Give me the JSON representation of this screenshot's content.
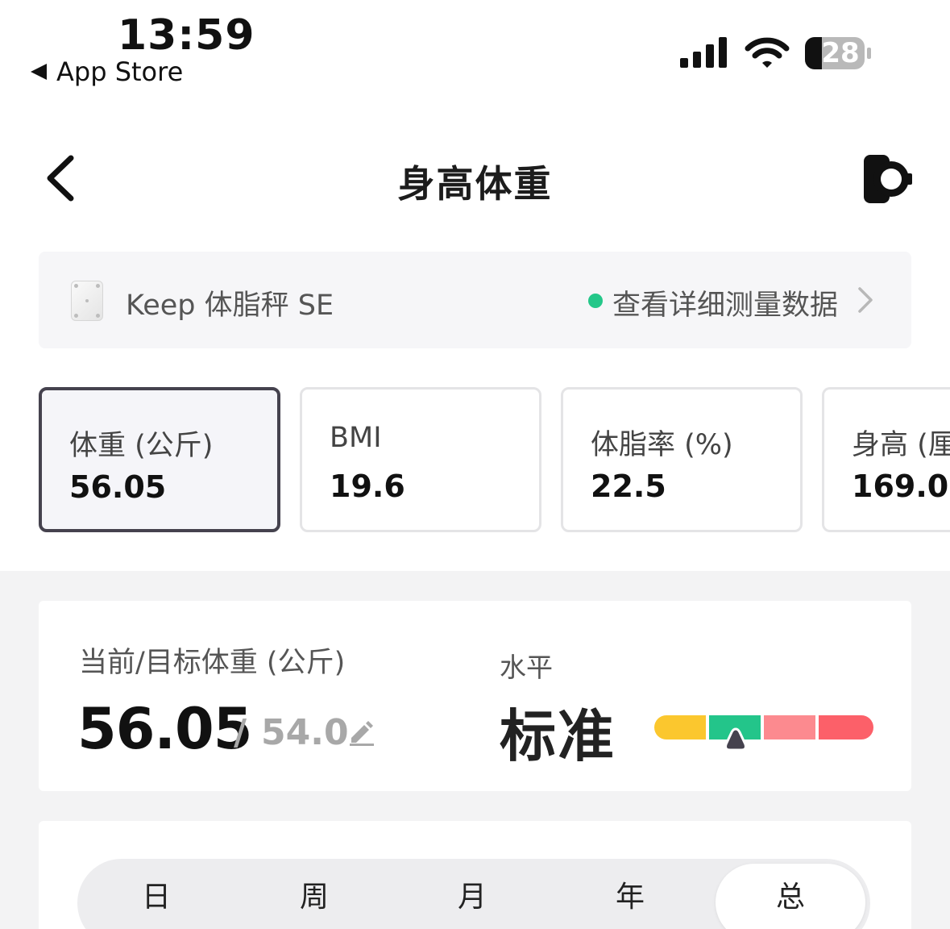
{
  "status_bar": {
    "time": "13:59",
    "back_app": "App Store",
    "battery": "28"
  },
  "nav": {
    "title": "身高体重",
    "icons": [
      "back-chevron-icon",
      "smartwatch-icon"
    ]
  },
  "device": {
    "name": "Keep 体脂秤 SE",
    "link": "查看详细测量数据",
    "status_color": "#24c789"
  },
  "metrics": [
    {
      "label": "体重 (公斤)",
      "value": "56.05",
      "selected": true
    },
    {
      "label": "BMI",
      "value": "19.6"
    },
    {
      "label": "体脂率 (%)",
      "value": "22.5"
    },
    {
      "label": "身高 (厘",
      "value": "169.0"
    }
  ],
  "weight": {
    "label": "当前/目标体重 (公斤)",
    "current": "56.05",
    "separator": "/",
    "target": "54.0",
    "level_label": "水平",
    "level": "标准",
    "level_scale": {
      "colors": [
        "#fbc72e",
        "#23c58a",
        "#fc8a8f",
        "#fc6069"
      ],
      "active_segment": 1,
      "marker_fraction": 0.37
    }
  },
  "periods": {
    "tabs": [
      "日",
      "周",
      "月",
      "年",
      "总"
    ],
    "selected_index": 4
  }
}
